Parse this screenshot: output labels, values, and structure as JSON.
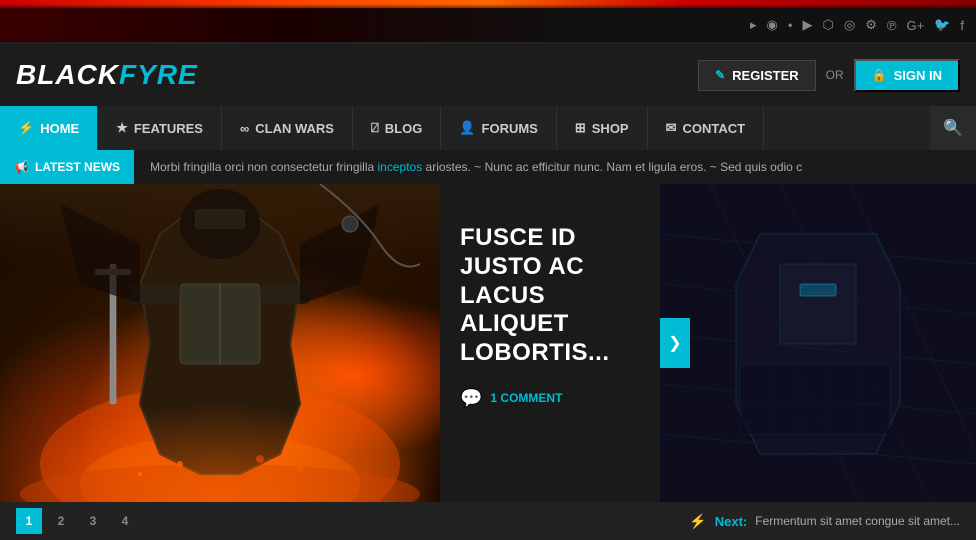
{
  "topbar": {
    "social_icons": [
      "rss",
      "dribbble",
      "vimeo",
      "youtube",
      "twitch",
      "instagram",
      "steam",
      "pinterest",
      "google-plus",
      "twitter",
      "facebook"
    ]
  },
  "header": {
    "logo": {
      "black_part": "BLACK",
      "fyre_part": "FYRE"
    },
    "register_label": "REGISTER",
    "or_label": "OR",
    "signin_label": "SIGN IN"
  },
  "nav": {
    "items": [
      {
        "label": "HOME",
        "icon": "⚡",
        "active": true
      },
      {
        "label": "FEATURES",
        "icon": "★",
        "active": false
      },
      {
        "label": "CLAN WARS",
        "icon": "∞",
        "active": false
      },
      {
        "label": "BLOG",
        "icon": "📡",
        "active": false
      },
      {
        "label": "FORUMS",
        "icon": "👥",
        "active": false
      },
      {
        "label": "SHOP",
        "icon": "🛒",
        "active": false
      },
      {
        "label": "CONTACT",
        "icon": "✉",
        "active": false
      }
    ],
    "search_placeholder": "Search..."
  },
  "ticker": {
    "label": "LATEST NEWS",
    "text": "Morbi fringilla orci non consectetur fringilla ",
    "highlight": "inceptos",
    "text2": " ariostes. ~   Nunc ac efficitur nunc. Nam et ligula eros. ~   Sed quis odio c"
  },
  "hero": {
    "title": "FUSCE ID JUSTO AC LACUS ALIQUET LOBORTIS...",
    "comment_count": "1 COMMENT"
  },
  "slider": {
    "dots": [
      "1",
      "2",
      "3",
      "4"
    ],
    "active_dot": 0
  },
  "next_preview": {
    "label": "Next:",
    "text": "Fermentum sit amet congue sit amet..."
  }
}
